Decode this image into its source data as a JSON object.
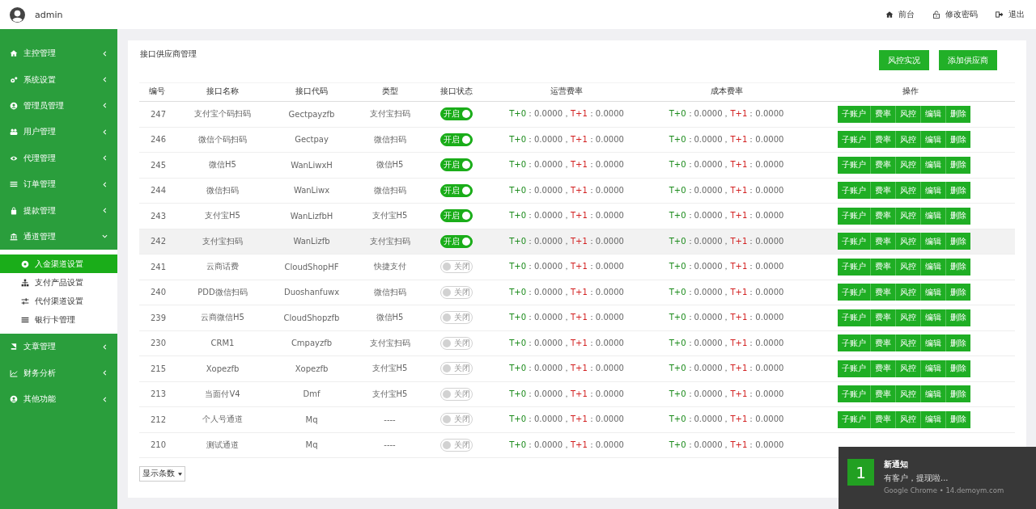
{
  "header": {
    "user": "admin",
    "links": [
      {
        "kind": "home",
        "label": "前台"
      },
      {
        "kind": "lock",
        "label": "修改密码"
      },
      {
        "kind": "logout",
        "label": "退出"
      }
    ]
  },
  "sidebar": {
    "items": [
      {
        "label": "主控管理",
        "expanded": false
      },
      {
        "label": "系统设置",
        "expanded": false
      },
      {
        "label": "管理员管理",
        "expanded": false
      },
      {
        "label": "用户管理",
        "expanded": false
      },
      {
        "label": "代理管理",
        "expanded": false
      },
      {
        "label": "订单管理",
        "expanded": false
      },
      {
        "label": "提款管理",
        "expanded": false
      },
      {
        "label": "通道管理",
        "expanded": true,
        "children": [
          {
            "label": "入金渠道设置",
            "selected": true
          },
          {
            "label": "支付产品设置",
            "selected": false
          },
          {
            "label": "代付渠道设置",
            "selected": false
          },
          {
            "label": "银行卡管理",
            "selected": false
          }
        ]
      },
      {
        "label": "文章管理",
        "expanded": false
      },
      {
        "label": "财务分析",
        "expanded": false
      },
      {
        "label": "其他功能",
        "expanded": false
      }
    ]
  },
  "panel": {
    "title": "接口供应商管理",
    "buttons": [
      "风控实况",
      "添加供应商"
    ],
    "table": {
      "columns": [
        "编号",
        "接口名称",
        "接口代码",
        "类型",
        "接口状态",
        "运营费率",
        "成本费率",
        "操作"
      ],
      "rows": [
        {
          "id": "247",
          "name": "支付宝个码扫码",
          "code": "Gectpayzfb",
          "type": "支付宝扫码",
          "on": true,
          "status": "开启",
          "highlighted": false,
          "op_rate": [
            "T+0",
            "：0.0000，",
            "T+1",
            "：0.0000"
          ],
          "cost_rate": [
            "T+0",
            "：0.0000，",
            "T+1",
            "：0.0000"
          ],
          "actions": [
            "子账户",
            "费率",
            "风控",
            "编辑",
            "删除"
          ]
        },
        {
          "id": "246",
          "name": "微信个码扫码",
          "code": "Gectpay",
          "type": "微信扫码",
          "on": true,
          "status": "开启",
          "highlighted": false,
          "op_rate": [
            "T+0",
            "：0.0000，",
            "T+1",
            "：0.0000"
          ],
          "cost_rate": [
            "T+0",
            "：0.0000，",
            "T+1",
            "：0.0000"
          ],
          "actions": [
            "子账户",
            "费率",
            "风控",
            "编辑",
            "删除"
          ]
        },
        {
          "id": "245",
          "name": "微信H5",
          "code": "WanLiwxH",
          "type": "微信H5",
          "on": true,
          "status": "开启",
          "highlighted": false,
          "op_rate": [
            "T+0",
            "：0.0000，",
            "T+1",
            "：0.0000"
          ],
          "cost_rate": [
            "T+0",
            "：0.0000，",
            "T+1",
            "：0.0000"
          ],
          "actions": [
            "子账户",
            "费率",
            "风控",
            "编辑",
            "删除"
          ]
        },
        {
          "id": "244",
          "name": "微信扫码",
          "code": "WanLiwx",
          "type": "微信扫码",
          "on": true,
          "status": "开启",
          "highlighted": false,
          "op_rate": [
            "T+0",
            "：0.0000，",
            "T+1",
            "：0.0000"
          ],
          "cost_rate": [
            "T+0",
            "：0.0000，",
            "T+1",
            "：0.0000"
          ],
          "actions": [
            "子账户",
            "费率",
            "风控",
            "编辑",
            "删除"
          ]
        },
        {
          "id": "243",
          "name": "支付宝H5",
          "code": "WanLizfbH",
          "type": "支付宝H5",
          "on": true,
          "status": "开启",
          "highlighted": false,
          "op_rate": [
            "T+0",
            "：0.0000，",
            "T+1",
            "：0.0000"
          ],
          "cost_rate": [
            "T+0",
            "：0.0000，",
            "T+1",
            "：0.0000"
          ],
          "actions": [
            "子账户",
            "费率",
            "风控",
            "编辑",
            "删除"
          ]
        },
        {
          "id": "242",
          "name": "支付宝扫码",
          "code": "WanLizfb",
          "type": "支付宝扫码",
          "on": true,
          "status": "开启",
          "highlighted": true,
          "op_rate": [
            "T+0",
            "：0.0000，",
            "T+1",
            "：0.0000"
          ],
          "cost_rate": [
            "T+0",
            "：0.0000，",
            "T+1",
            "：0.0000"
          ],
          "actions": [
            "子账户",
            "费率",
            "风控",
            "编辑",
            "删除"
          ]
        },
        {
          "id": "241",
          "name": "云商话费",
          "code": "CloudShopHF",
          "type": "快捷支付",
          "on": false,
          "status": "关闭",
          "highlighted": false,
          "op_rate": [
            "T+0",
            "：0.0000，",
            "T+1",
            "：0.0000"
          ],
          "cost_rate": [
            "T+0",
            "：0.0000，",
            "T+1",
            "：0.0000"
          ],
          "actions": [
            "子账户",
            "费率",
            "风控",
            "编辑",
            "删除"
          ]
        },
        {
          "id": "240",
          "name": "PDD微信扫码",
          "code": "Duoshanfuwx",
          "type": "微信扫码",
          "on": false,
          "status": "关闭",
          "highlighted": false,
          "op_rate": [
            "T+0",
            "：0.0000，",
            "T+1",
            "：0.0000"
          ],
          "cost_rate": [
            "T+0",
            "：0.0000，",
            "T+1",
            "：0.0000"
          ],
          "actions": [
            "子账户",
            "费率",
            "风控",
            "编辑",
            "删除"
          ]
        },
        {
          "id": "239",
          "name": "云商微信H5",
          "code": "CloudShopzfb",
          "type": "微信H5",
          "on": false,
          "status": "关闭",
          "highlighted": false,
          "op_rate": [
            "T+0",
            "：0.0000，",
            "T+1",
            "：0.0000"
          ],
          "cost_rate": [
            "T+0",
            "：0.0000，",
            "T+1",
            "：0.0000"
          ],
          "actions": [
            "子账户",
            "费率",
            "风控",
            "编辑",
            "删除"
          ]
        },
        {
          "id": "230",
          "name": "CRM1",
          "code": "Cmpayzfb",
          "type": "支付宝扫码",
          "on": false,
          "status": "关闭",
          "highlighted": false,
          "op_rate": [
            "T+0",
            "：0.0000，",
            "T+1",
            "：0.0000"
          ],
          "cost_rate": [
            "T+0",
            "：0.0000，",
            "T+1",
            "：0.0000"
          ],
          "actions": [
            "子账户",
            "费率",
            "风控",
            "编辑",
            "删除"
          ]
        },
        {
          "id": "215",
          "name": "Xopezfb",
          "code": "Xopezfb",
          "type": "支付宝H5",
          "on": false,
          "status": "关闭",
          "highlighted": false,
          "op_rate": [
            "T+0",
            "：0.0000，",
            "T+1",
            "：0.0000"
          ],
          "cost_rate": [
            "T+0",
            "：0.0000，",
            "T+1",
            "：0.0000"
          ],
          "actions": [
            "子账户",
            "费率",
            "风控",
            "编辑",
            "删除"
          ]
        },
        {
          "id": "213",
          "name": "当面付V4",
          "code": "Dmf",
          "type": "支付宝H5",
          "on": false,
          "status": "关闭",
          "highlighted": false,
          "op_rate": [
            "T+0",
            "：0.0000，",
            "T+1",
            "：0.0000"
          ],
          "cost_rate": [
            "T+0",
            "：0.0000，",
            "T+1",
            "：0.0000"
          ],
          "actions": [
            "子账户",
            "费率",
            "风控",
            "编辑",
            "删除"
          ]
        },
        {
          "id": "212",
          "name": "个人号通道",
          "code": "Mq",
          "type": "----",
          "on": false,
          "status": "关闭",
          "highlighted": false,
          "op_rate": [
            "T+0",
            "：0.0000，",
            "T+1",
            "：0.0000"
          ],
          "cost_rate": [
            "T+0",
            "：0.0000，",
            "T+1",
            "：0.0000"
          ],
          "actions": [
            "子账户",
            "费率",
            "风控",
            "编辑",
            "删除"
          ]
        },
        {
          "id": "210",
          "name": "测试通道",
          "code": "Mq",
          "type": "----",
          "on": false,
          "status": "关闭",
          "highlighted": false,
          "op_rate": [
            "T+0",
            "：0.0000，",
            "T+1",
            "：0.0000"
          ],
          "cost_rate": [
            "T+0",
            "：0.0000，",
            "T+1",
            "：0.0000"
          ]
        }
      ]
    },
    "page_size": {
      "label": "显示条数"
    }
  },
  "notification": {
    "count": "1",
    "title": "新通知",
    "message": "有客户，提现啦...",
    "source": "Google Chrome • 14.demoym.com"
  }
}
